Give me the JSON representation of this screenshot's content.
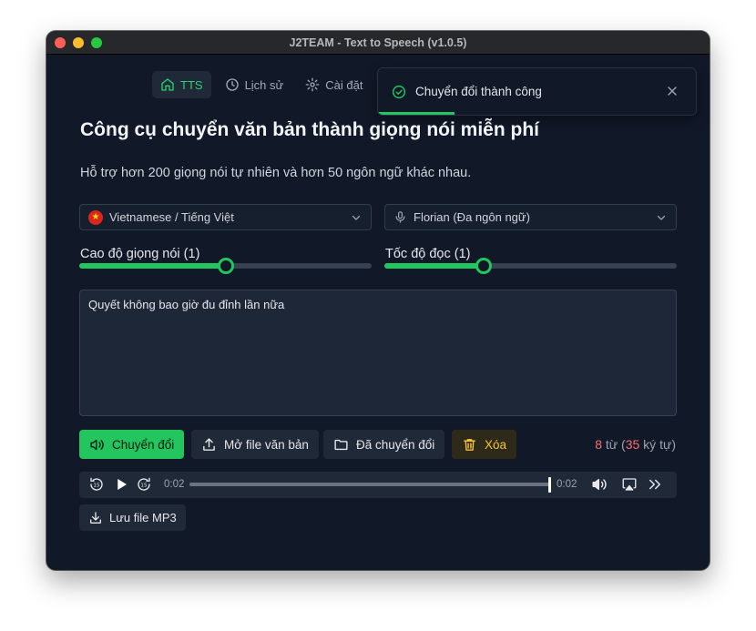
{
  "window": {
    "title": "J2TEAM - Text to Speech (v1.0.5)"
  },
  "nav": {
    "tts": "TTS",
    "history": "Lịch sử",
    "settings": "Cài đặt"
  },
  "toast": {
    "message": "Chuyển đổi thành công"
  },
  "main": {
    "heading": "Công cụ chuyển văn bản thành giọng nói miễn phí",
    "subtitle": "Hỗ trợ hơn 200 giọng nói tự nhiên và hơn 50 ngôn ngữ khác nhau.",
    "language_select": "Vietnamese / Tiếng Việt",
    "voice_select": "Florian (Đa ngôn ngữ)",
    "pitch": {
      "label": "Cao độ giọng nói (1)",
      "level_fraction": 0.5
    },
    "speed": {
      "label": "Tốc độ đọc (1)",
      "level_fraction": 0.34
    },
    "text_input": "Quyết không bao giờ đu đỉnh lần nữa"
  },
  "actions": {
    "convert": "Chuyển đổi",
    "open_file": "Mở file văn bản",
    "converted": "Đã chuyển đổi",
    "delete": "Xóa"
  },
  "counter": {
    "words": "8",
    "words_label": " từ (",
    "chars": "35",
    "chars_label": " ký tự)"
  },
  "player": {
    "current_time": "0:02",
    "duration": "0:02",
    "progress_fraction": 1.0
  },
  "save_mp3": "Lưu file MP3",
  "colors": {
    "accent": "#22c55e",
    "background": "#111827",
    "warning": "#f6c333",
    "count_highlight": "#f87171"
  }
}
